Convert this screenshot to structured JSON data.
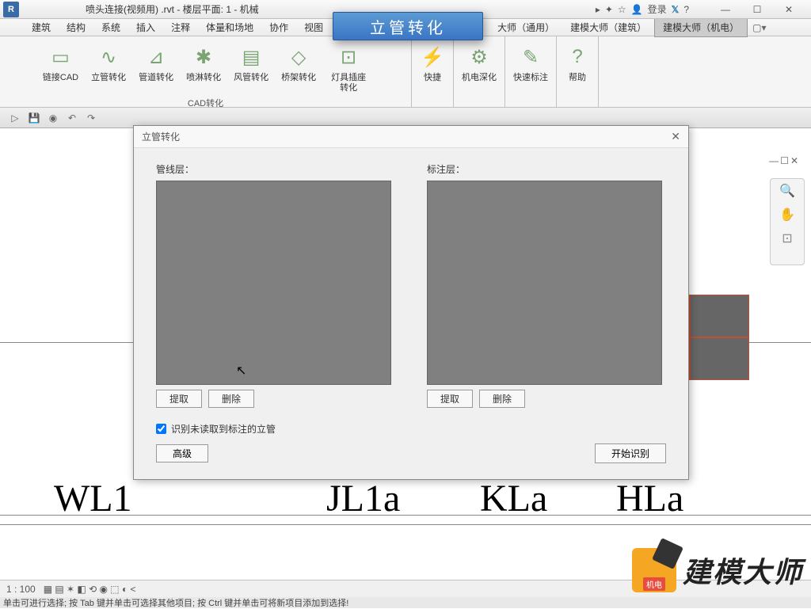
{
  "title": "喷头连接(视频用) .rvt - 楼层平面: 1 - 机械",
  "login": "登录",
  "help_x": "✕",
  "menus": [
    "建筑",
    "结构",
    "系统",
    "插入",
    "注释",
    "体量和场地",
    "协作",
    "视图",
    "…",
    "大师（通用）",
    "建模大师（建筑）",
    "建模大师（机电）"
  ],
  "ribbon": {
    "group1_label": "CAD转化",
    "btns": [
      {
        "label": "链接CAD",
        "icon": "▭"
      },
      {
        "label": "立管转化",
        "icon": "∿"
      },
      {
        "label": "管道转化",
        "icon": "⊿"
      },
      {
        "label": "喷淋转化",
        "icon": "✱"
      },
      {
        "label": "风管转化",
        "icon": "▤"
      },
      {
        "label": "桥架转化",
        "icon": "◇"
      },
      {
        "label": "灯具插座转化",
        "icon": "⊡"
      }
    ],
    "g2": [
      {
        "label": "快捷",
        "icon": "⚡"
      },
      {
        "label": "机电深化",
        "icon": "⚙"
      },
      {
        "label": "快速标注",
        "icon": "✎"
      },
      {
        "label": "帮助",
        "icon": "?"
      }
    ]
  },
  "callout": "立管转化",
  "dialog": {
    "title": "立管转化",
    "col1": "管线层：",
    "col2": "标注层：",
    "extract": "提取",
    "delete": "删除",
    "checkbox": "识别未读取到标注的立管",
    "advanced": "高级",
    "start": "开始识别"
  },
  "canvas_texts": {
    "wl1": "WL1",
    "jl1a": "JL1a",
    "kla": "KLa",
    "hla": "HLa"
  },
  "status": {
    "scale": "1 : 100"
  },
  "hint": "单击可进行选择; 按 Tab 键并单击可选择其他项目; 按 Ctrl 键并单击可将新项目添加到选择!",
  "brand": {
    "tag": "机电",
    "text": "建模大师"
  }
}
